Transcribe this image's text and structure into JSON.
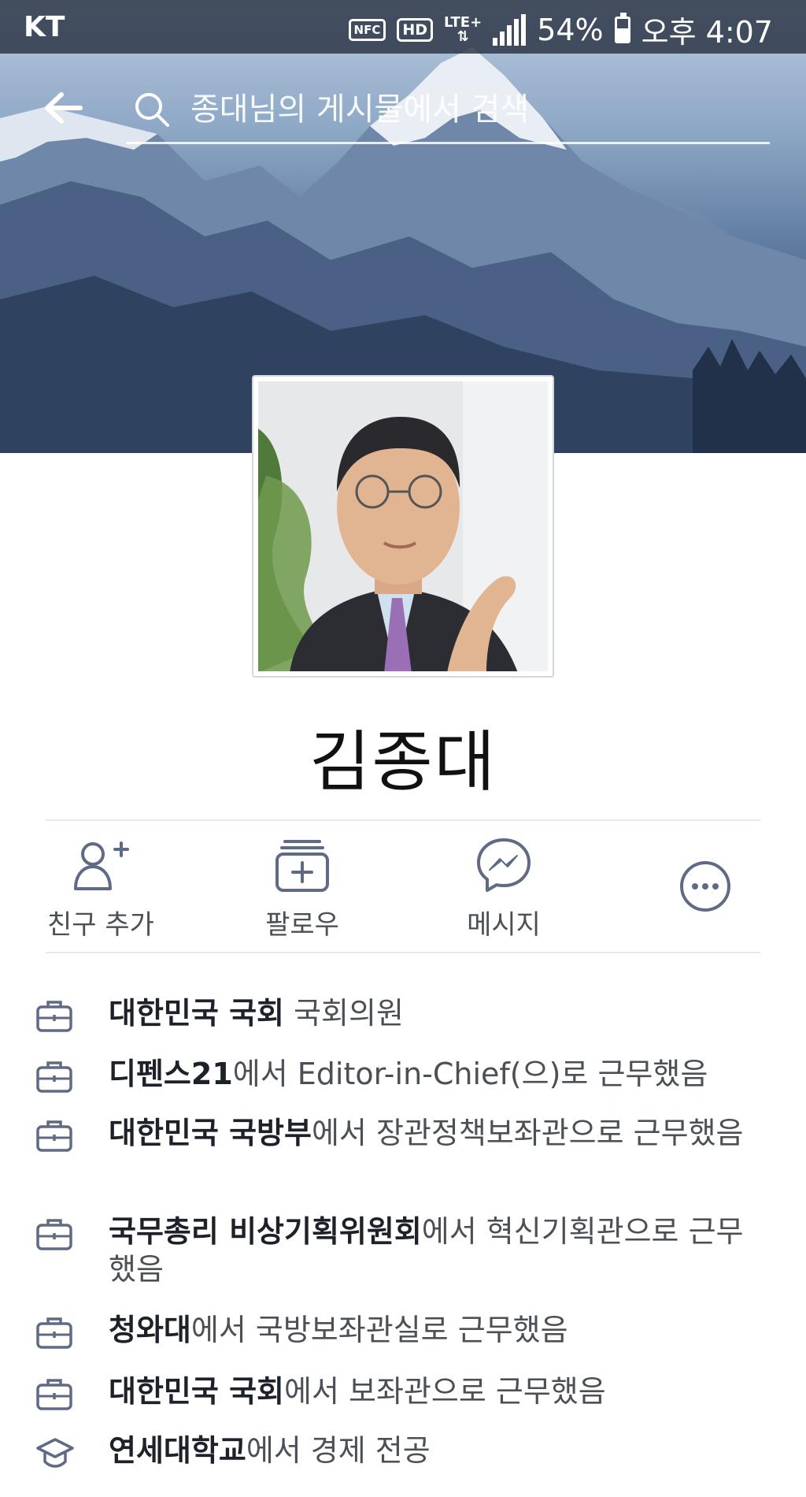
{
  "status_bar": {
    "carrier": "KT",
    "nfc": "NFC",
    "hd": "HD",
    "network": "LTE+",
    "battery": "54%",
    "battery_level": 0.54,
    "time": "오후 4:07"
  },
  "header": {
    "search_placeholder": "종대님의 게시물에서 검색"
  },
  "profile": {
    "name": "김종대"
  },
  "actions": [
    {
      "label": "친구 추가",
      "icon": "add-friend-icon"
    },
    {
      "label": "팔로우",
      "icon": "follow-icon"
    },
    {
      "label": "메시지",
      "icon": "messenger-icon"
    },
    {
      "label": "",
      "icon": "more-icon"
    }
  ],
  "info": [
    {
      "icon": "briefcase-icon",
      "org": "대한민국 국회",
      "suffix": " 국회의원"
    },
    {
      "icon": "briefcase-icon",
      "org": "디펜스21",
      "suffix": "에서 Editor-in-Chief(으)로 근무했음"
    },
    {
      "icon": "briefcase-icon",
      "org": "대한민국 국방부",
      "suffix": "에서 장관정책보좌관으로 근무했음"
    },
    {
      "icon": "briefcase-icon",
      "org": "국무총리 비상기획위원회",
      "suffix": "에서 혁신기획관으로 근무했음"
    },
    {
      "icon": "briefcase-icon",
      "org": "청와대",
      "suffix": "에서 국방보좌관실로 근무했음"
    },
    {
      "icon": "briefcase-icon",
      "org": "대한민국 국회",
      "suffix": "에서 보좌관으로 근무했음"
    },
    {
      "icon": "graduation-cap-icon",
      "org": "연세대학교",
      "suffix": "에서 경제 전공"
    }
  ],
  "colors": {
    "status_bar": "#28324a",
    "icon_gray": "#5f6b84",
    "text_dark": "#1d2129",
    "text_gray": "#4b4f56"
  }
}
